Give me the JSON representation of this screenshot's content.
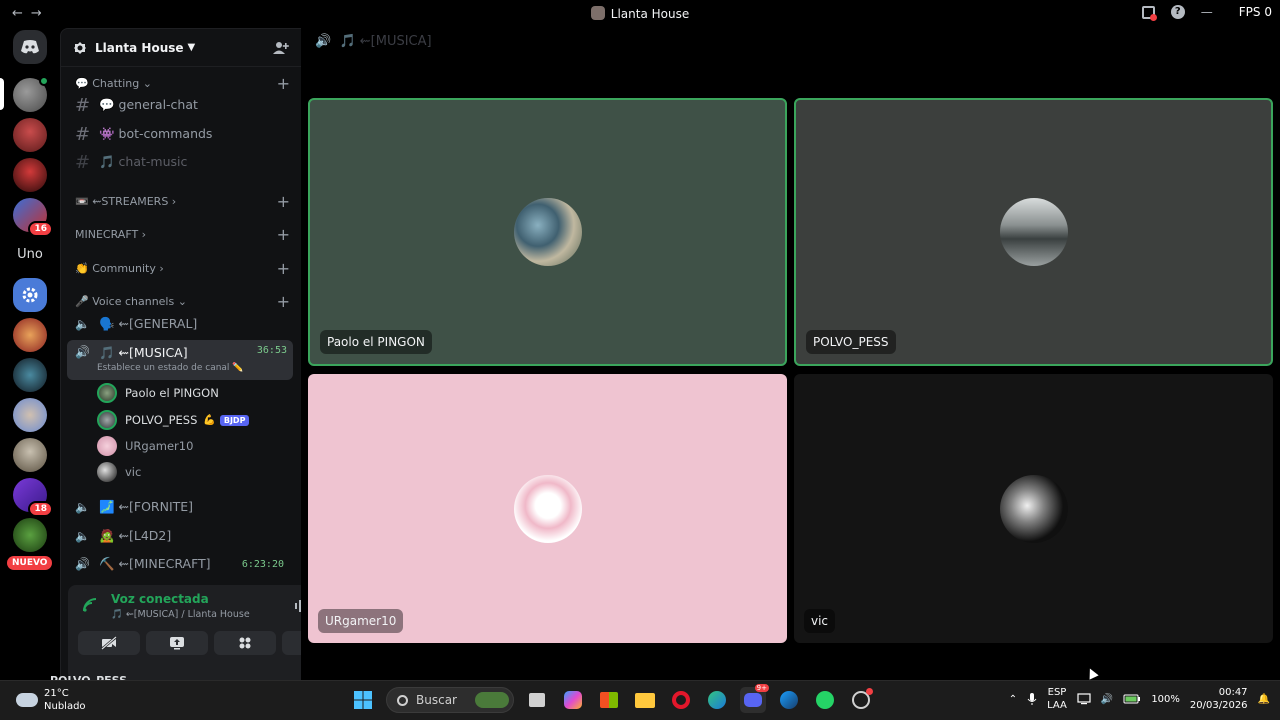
{
  "window": {
    "title": "Llanta House",
    "fps_label": "FPS 0"
  },
  "server": {
    "name": "Llanta House"
  },
  "sidebar": {
    "categories": {
      "chatting": "💬 Chatting",
      "streamers": "📼 ⇜STREAMERS",
      "minecraft": "MINECRAFT",
      "community": "👏 Community",
      "voice": "🎤 Voice channels"
    },
    "text_channels": [
      {
        "label": "💬 general-chat"
      },
      {
        "label": "👾 bot-commands"
      },
      {
        "label": "🎵 chat-music"
      }
    ],
    "voice_channels": {
      "general": "🗣️ ⇜[GENERAL]",
      "musica": "🎵 ⇜[MUSICA]",
      "musica_time": "36:53",
      "musica_status": "Establece un estado de canal ✏️",
      "fornite": "🗾 ⇜[FORNITE]",
      "l4d2": "🧟 ⇜[L4D2]",
      "minecraft": "⛏️ ⇜[MINECRAFT]",
      "minecraft_time": "6:23:20"
    },
    "voice_users": [
      {
        "name": "Paolo el PINGON"
      },
      {
        "name": "POLVO_PESS",
        "tag": "BJDP"
      },
      {
        "name": "URgamer10"
      },
      {
        "name": "vic"
      }
    ]
  },
  "guilds": {
    "uno_label": "Uno",
    "nuevo_label": "NUEVO",
    "badges": [
      "16",
      "18"
    ]
  },
  "voice_panel": {
    "status": "Voz conectada",
    "channel": "🎵 ⇜[MUSICA] / Llanta House"
  },
  "user_bar": {
    "name": "POLVO_PESS"
  },
  "main": {
    "channel_header": "🎵 ⇜[MUSICA]",
    "tiles": [
      {
        "name": "Paolo el PINGON",
        "speaking": true
      },
      {
        "name": "POLVO_PESS",
        "speaking": true
      },
      {
        "name": "URgamer10",
        "speaking": false
      },
      {
        "name": "vic",
        "speaking": false
      }
    ]
  },
  "taskbar": {
    "temperature": "21°C",
    "weather": "Nublado",
    "search_placeholder": "Buscar",
    "lang_line1": "ESP",
    "lang_line2": "LAA",
    "battery": "100%",
    "time": "00:47",
    "date": "20/03/2026",
    "discord_badge": "9+"
  },
  "colors": {
    "speaking_border": "#3ba55c",
    "tile_green": "#3f5147",
    "tile_gray": "#3c3f3d",
    "tile_pink": "#efc4d1",
    "tile_black": "#141414",
    "badge_red": "#f23f43"
  }
}
